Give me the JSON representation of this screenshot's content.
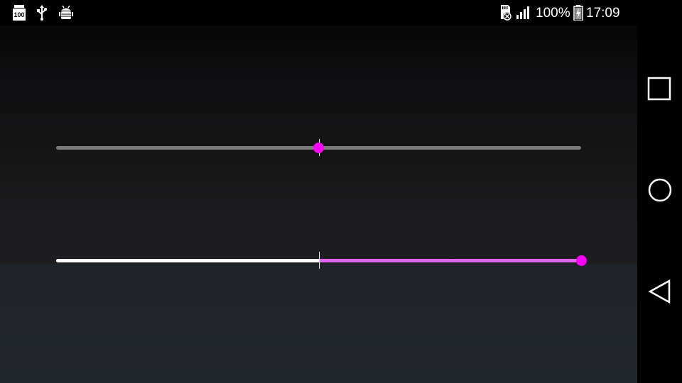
{
  "statusbar": {
    "battery_percent": "100%",
    "time": "17:09",
    "icons_left": [
      "storage-100-icon",
      "usb-icon",
      "android-debug-icon"
    ],
    "icons_right": [
      "sd-card-error-icon",
      "signal-icon",
      "battery-charging-icon"
    ]
  },
  "sliders": [
    {
      "name": "top-slider",
      "value": 0.0,
      "min": -1,
      "max": 1,
      "active_color": "#ff0000",
      "inactive_color": "#7a7a7a",
      "thumb_color": "#ff00ff"
    },
    {
      "name": "bottom-slider",
      "value": 1.0,
      "min": -1,
      "max": 1,
      "active_color": "#e066ee",
      "inactive_color": "#ffffff",
      "thumb_color": "#ff00ff"
    }
  ],
  "navbar": {
    "buttons": [
      "recents-icon",
      "home-icon",
      "back-icon"
    ]
  }
}
